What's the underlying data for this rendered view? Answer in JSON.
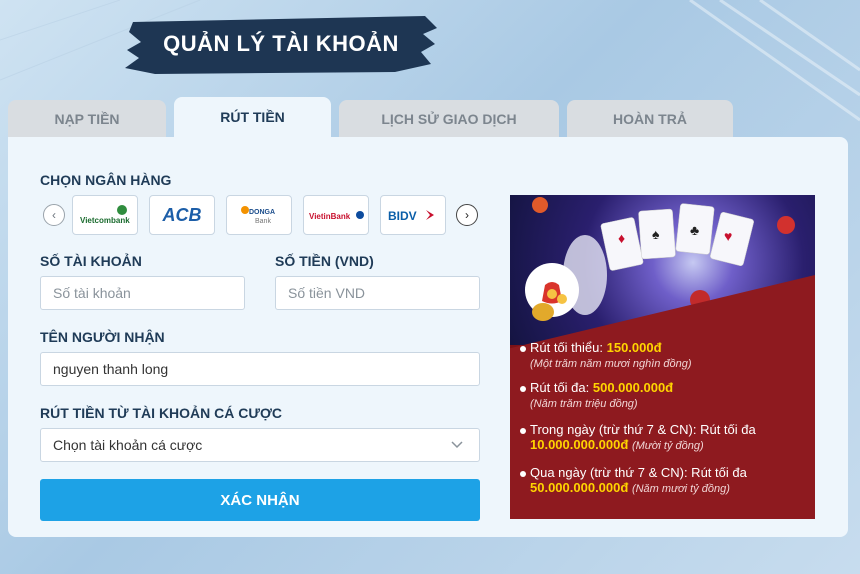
{
  "page": {
    "title": "QUẢN LÝ TÀI KHOẢN"
  },
  "tabs": [
    {
      "label": "NẠP TIỀN",
      "active": false
    },
    {
      "label": "RÚT TIỀN",
      "active": true
    },
    {
      "label": "LỊCH SỬ GIAO DỊCH",
      "active": false
    },
    {
      "label": "HOÀN TRẢ",
      "active": false
    }
  ],
  "bank_section": {
    "label": "CHỌN NGÂN HÀNG",
    "banks": [
      {
        "name": "Vietcombank"
      },
      {
        "name": "ACB"
      },
      {
        "name": "DONGA Bank"
      },
      {
        "name": "VietinBank"
      },
      {
        "name": "BIDV"
      }
    ]
  },
  "form": {
    "account_number": {
      "label": "SỐ TÀI KHOẢN",
      "placeholder": "Số tài khoản",
      "value": ""
    },
    "amount": {
      "label": "SỐ TIỀN (VND)",
      "placeholder": "Số tiền VND",
      "value": ""
    },
    "recipient": {
      "label": "TÊN NGƯỜI NHẬN",
      "value": "nguyen thanh long"
    },
    "betting_account": {
      "label": "RÚT TIỀN TỪ TÀI KHOẢN CÁ CƯỢC",
      "selected": "Chọn tài khoản cá cược"
    },
    "submit_label": "XÁC NHẬN"
  },
  "promo": {
    "lines": [
      {
        "text": "Rút tối thiểu: ",
        "highlight": "150.000đ",
        "note": "(Một trăm năm mươi nghìn đồng)"
      },
      {
        "text": "Rút tối đa: ",
        "highlight": "500.000.000đ",
        "note": "(Năm trăm triệu đồng)"
      },
      {
        "text": "Trong ngày (trừ thứ 7 & CN): Rút tối đa",
        "highlight": "10.000.000.000đ",
        "note": "(Mười tỷ đồng)"
      },
      {
        "text": "Qua ngày (trừ thứ 7 & CN): Rút tối đa",
        "highlight": "50.000.000.000đ",
        "note": "(Năm mươi tỷ đồng)"
      }
    ]
  },
  "colors": {
    "accent": "#1da2e6",
    "highlight": "#ffd400",
    "promo_red": "#8e1a1f",
    "heading": "#1f3b57"
  },
  "icons": {
    "bank_prev": "chevron-left-icon",
    "bank_next": "chevron-right-icon",
    "select_chevron": "chevron-down-icon",
    "money_bag": "money-bag-icon"
  }
}
